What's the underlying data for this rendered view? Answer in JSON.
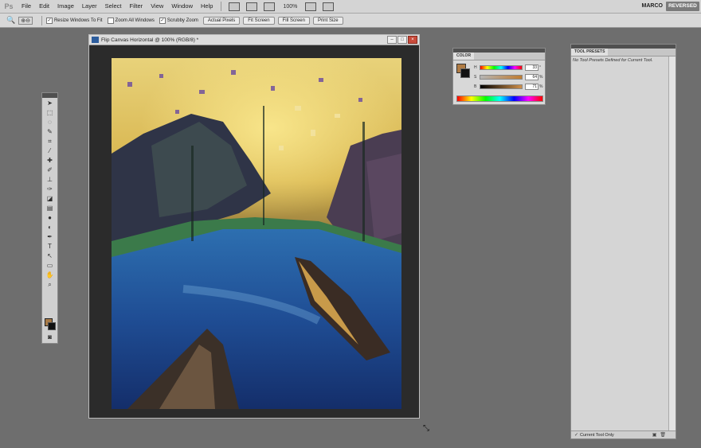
{
  "app": {
    "logo": "Ps"
  },
  "menubar": {
    "items": [
      "File",
      "Edit",
      "Image",
      "Layer",
      "Select",
      "Filter",
      "View",
      "Window",
      "Help"
    ],
    "zoom": "100%",
    "workspace_user": "MARCO",
    "workspace_mode": "REVERSED"
  },
  "options_bar": {
    "resize_windows": "Resize Windows To Fit",
    "zoom_all": "Zoom All Windows",
    "scrubby_zoom": "Scrubby Zoom",
    "actual_pixels": "Actual Pixels",
    "fit_screen": "Fit Screen",
    "fill_screen": "Fill Screen",
    "print_size": "Print Size",
    "resize_checked": "✓",
    "scrubby_checked": "✓"
  },
  "document": {
    "title": "Flip Canvas Horizontal @ 100% (RGB/8) *"
  },
  "color_panel": {
    "tab": "COLOR",
    "h": {
      "label": "H",
      "value": "33",
      "unit": "°"
    },
    "s": {
      "label": "S",
      "value": "64",
      "unit": "%"
    },
    "b": {
      "label": "B",
      "value": "71",
      "unit": "%"
    },
    "foreground": "#b07c44",
    "background": "#111111"
  },
  "tool_presets": {
    "tab": "TOOL PRESETS",
    "message": "No Tool Presets Defined for Current Tool.",
    "current_tool_only": "Current Tool Only",
    "current_tool_checked": "✓"
  },
  "tools": [
    "move-icon",
    "marquee-icon",
    "lasso-icon",
    "quick-select-icon",
    "crop-icon",
    "eyedropper-icon",
    "healing-icon",
    "brush-icon",
    "stamp-icon",
    "history-brush-icon",
    "eraser-icon",
    "gradient-icon",
    "blur-icon",
    "dodge-icon",
    "pen-icon",
    "type-icon",
    "path-select-icon",
    "shape-icon",
    "hand-icon",
    "zoom-icon"
  ]
}
